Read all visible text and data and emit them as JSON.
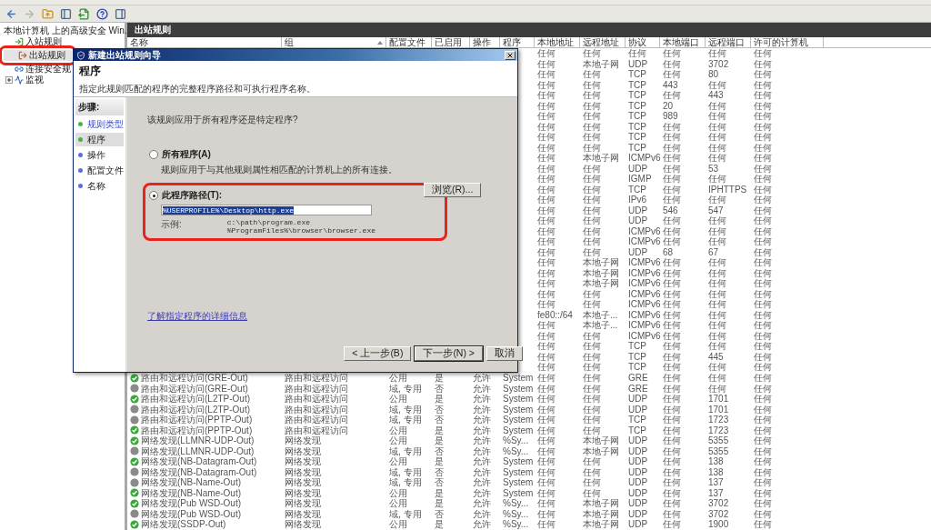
{
  "toolbar": [
    {
      "disabled": false
    },
    {
      "disabled": true
    },
    {
      "disabled": false
    },
    {
      "disabled": false
    },
    {
      "disabled": false
    },
    {
      "disabled": false
    },
    {
      "disabled": false
    }
  ],
  "tree": {
    "root": "本地计算机 上的高级安全 Win.",
    "items": [
      {
        "label": "入站规则",
        "selected": false,
        "highlighted": false
      },
      {
        "label": "出站规则",
        "selected": true,
        "highlighted": true
      },
      {
        "label": "连接安全规",
        "selected": false,
        "highlighted": false
      },
      {
        "label": "监视",
        "selected": false,
        "highlighted": false,
        "expanded": false
      }
    ]
  },
  "panel_title": "出站规则",
  "table": {
    "columns": [
      {
        "label": "名称",
        "sorted": false
      },
      {
        "label": "组",
        "sorted": true
      },
      {
        "label": "配置文件",
        "sorted": false
      },
      {
        "label": "已启用",
        "sorted": false
      },
      {
        "label": "操作",
        "sorted": false
      },
      {
        "label": "程序",
        "sorted": false
      },
      {
        "label": "本地地址",
        "sorted": false
      },
      {
        "label": "远程地址",
        "sorted": false
      },
      {
        "label": "协议",
        "sorted": false
      },
      {
        "label": "本地端口",
        "sorted": false
      },
      {
        "label": "远程端口",
        "sorted": false
      },
      {
        "label": "许可的计算机",
        "sorted": false
      }
    ],
    "rows": [
      {
        "kind": "partial",
        "cells": [
          "任何",
          "任何",
          "任何",
          "任何",
          "任何",
          "任何"
        ]
      },
      {
        "kind": "partial",
        "cells": [
          "任何",
          "本地子网",
          "UDP",
          "任何",
          "3702",
          "任何"
        ]
      },
      {
        "kind": "partial",
        "cells": [
          "任何",
          "任何",
          "TCP",
          "任何",
          "80",
          "任何"
        ]
      },
      {
        "kind": "partial",
        "cells": [
          "任何",
          "任何",
          "TCP",
          "443",
          "任何",
          "任何"
        ]
      },
      {
        "kind": "partial",
        "cells": [
          "任何",
          "任何",
          "TCP",
          "任何",
          "443",
          "任何"
        ]
      },
      {
        "kind": "partial",
        "cells": [
          "任何",
          "任何",
          "TCP",
          "20",
          "任何",
          "任何"
        ]
      },
      {
        "kind": "partial",
        "cells": [
          "任何",
          "任何",
          "TCP",
          "989",
          "任何",
          "任何"
        ]
      },
      {
        "kind": "partial",
        "cells": [
          "任何",
          "任何",
          "TCP",
          "任何",
          "任何",
          "任何"
        ]
      },
      {
        "kind": "partial",
        "cells": [
          "任何",
          "任何",
          "TCP",
          "任何",
          "任何",
          "任何"
        ]
      },
      {
        "kind": "partial",
        "cells": [
          "任何",
          "任何",
          "TCP",
          "任何",
          "任何",
          "任何"
        ]
      },
      {
        "kind": "partial",
        "cells": [
          "任何",
          "本地子网",
          "ICMPv6",
          "任何",
          "任何",
          "任何"
        ]
      },
      {
        "kind": "partial",
        "cells": [
          "任何",
          "任何",
          "UDP",
          "任何",
          "53",
          "任何"
        ]
      },
      {
        "kind": "partial",
        "cells": [
          "任何",
          "任何",
          "IGMP",
          "任何",
          "任何",
          "任何"
        ]
      },
      {
        "kind": "partial",
        "cells": [
          "任何",
          "任何",
          "TCP",
          "任何",
          "IPHTTPS",
          "任何"
        ]
      },
      {
        "kind": "partial",
        "cells": [
          "任何",
          "任何",
          "IPv6",
          "任何",
          "任何",
          "任何"
        ]
      },
      {
        "kind": "partial",
        "cells": [
          "任何",
          "任何",
          "UDP",
          "546",
          "547",
          "任何"
        ]
      },
      {
        "kind": "partial",
        "cells": [
          "任何",
          "任何",
          "UDP",
          "任何",
          "任何",
          "任何"
        ]
      },
      {
        "kind": "partial",
        "cells": [
          "任何",
          "任何",
          "ICMPv6",
          "任何",
          "任何",
          "任何"
        ]
      },
      {
        "kind": "partial",
        "cells": [
          "任何",
          "任何",
          "ICMPv6",
          "任何",
          "任何",
          "任何"
        ]
      },
      {
        "kind": "partial",
        "cells": [
          "任何",
          "任何",
          "UDP",
          "68",
          "67",
          "任何"
        ]
      },
      {
        "kind": "partial",
        "cells": [
          "任何",
          "本地子网",
          "ICMPv6",
          "任何",
          "任何",
          "任何"
        ]
      },
      {
        "kind": "partial",
        "cells": [
          "任何",
          "本地子网",
          "ICMPv6",
          "任何",
          "任何",
          "任何"
        ]
      },
      {
        "kind": "partial",
        "cells": [
          "任何",
          "本地子网",
          "ICMPv6",
          "任何",
          "任何",
          "任何"
        ]
      },
      {
        "kind": "partial",
        "cells": [
          "任何",
          "任何",
          "ICMPv6",
          "任何",
          "任何",
          "任何"
        ]
      },
      {
        "kind": "partial",
        "cells": [
          "任何",
          "任何",
          "ICMPv6",
          "任何",
          "任何",
          "任何"
        ]
      },
      {
        "kind": "partial",
        "cells": [
          "fe80::/64",
          "本地子...",
          "ICMPv6",
          "任何",
          "任何",
          "任何"
        ]
      },
      {
        "kind": "partial",
        "cells": [
          "任何",
          "本地子...",
          "ICMPv6",
          "任何",
          "任何",
          "任何"
        ]
      },
      {
        "kind": "partial",
        "cells": [
          "任何",
          "任何",
          "ICMPv6",
          "任何",
          "任何",
          "任何"
        ]
      },
      {
        "kind": "partial",
        "cells": [
          "任何",
          "任何",
          "TCP",
          "任何",
          "任何",
          "任何"
        ]
      },
      {
        "kind": "partial",
        "cells": [
          "任何",
          "任何",
          "TCP",
          "任何",
          "445",
          "任何"
        ]
      },
      {
        "kind": "partial",
        "cells": [
          "任何",
          "任何",
          "TCP",
          "任何",
          "任何",
          "任何"
        ]
      },
      {
        "kind": "full",
        "on": true,
        "cells": [
          "路由和远程访问(GRE-Out)",
          "路由和远程访问",
          "公用",
          "是",
          "允许",
          "System",
          "任何",
          "任何",
          "GRE",
          "任何",
          "任何",
          "任何"
        ]
      },
      {
        "kind": "full",
        "on": false,
        "cells": [
          "路由和远程访问(GRE-Out)",
          "路由和远程访问",
          "域, 专用",
          "否",
          "允许",
          "System",
          "任何",
          "任何",
          "GRE",
          "任何",
          "任何",
          "任何"
        ]
      },
      {
        "kind": "full",
        "on": true,
        "cells": [
          "路由和远程访问(L2TP-Out)",
          "路由和远程访问",
          "公用",
          "是",
          "允许",
          "System",
          "任何",
          "任何",
          "UDP",
          "任何",
          "1701",
          "任何"
        ]
      },
      {
        "kind": "full",
        "on": false,
        "cells": [
          "路由和远程访问(L2TP-Out)",
          "路由和远程访问",
          "域, 专用",
          "否",
          "允许",
          "System",
          "任何",
          "任何",
          "UDP",
          "任何",
          "1701",
          "任何"
        ]
      },
      {
        "kind": "full",
        "on": false,
        "cells": [
          "路由和远程访问(PPTP-Out)",
          "路由和远程访问",
          "域, 专用",
          "否",
          "允许",
          "System",
          "任何",
          "任何",
          "TCP",
          "任何",
          "1723",
          "任何"
        ]
      },
      {
        "kind": "full",
        "on": true,
        "cells": [
          "路由和远程访问(PPTP-Out)",
          "路由和远程访问",
          "公用",
          "是",
          "允许",
          "System",
          "任何",
          "任何",
          "TCP",
          "任何",
          "1723",
          "任何"
        ]
      },
      {
        "kind": "full",
        "on": true,
        "cells": [
          "网络发现(LLMNR-UDP-Out)",
          "网络发现",
          "公用",
          "是",
          "允许",
          "%Sy...",
          "任何",
          "本地子网",
          "UDP",
          "任何",
          "5355",
          "任何"
        ]
      },
      {
        "kind": "full",
        "on": false,
        "cells": [
          "网络发现(LLMNR-UDP-Out)",
          "网络发现",
          "域, 专用",
          "否",
          "允许",
          "%Sy...",
          "任何",
          "本地子网",
          "UDP",
          "任何",
          "5355",
          "任何"
        ]
      },
      {
        "kind": "full",
        "on": true,
        "cells": [
          "网络发现(NB-Datagram-Out)",
          "网络发现",
          "公用",
          "是",
          "允许",
          "System",
          "任何",
          "任何",
          "UDP",
          "任何",
          "138",
          "任何"
        ]
      },
      {
        "kind": "full",
        "on": false,
        "cells": [
          "网络发现(NB-Datagram-Out)",
          "网络发现",
          "域, 专用",
          "否",
          "允许",
          "System",
          "任何",
          "任何",
          "UDP",
          "任何",
          "138",
          "任何"
        ]
      },
      {
        "kind": "full",
        "on": false,
        "cells": [
          "网络发现(NB-Name-Out)",
          "网络发现",
          "域, 专用",
          "否",
          "允许",
          "System",
          "任何",
          "任何",
          "UDP",
          "任何",
          "137",
          "任何"
        ]
      },
      {
        "kind": "full",
        "on": true,
        "cells": [
          "网络发现(NB-Name-Out)",
          "网络发现",
          "公用",
          "是",
          "允许",
          "System",
          "任何",
          "任何",
          "UDP",
          "任何",
          "137",
          "任何"
        ]
      },
      {
        "kind": "full",
        "on": true,
        "cells": [
          "网络发现(Pub WSD-Out)",
          "网络发现",
          "公用",
          "是",
          "允许",
          "%Sy...",
          "任何",
          "本地子网",
          "UDP",
          "任何",
          "3702",
          "任何"
        ]
      },
      {
        "kind": "full",
        "on": false,
        "cells": [
          "网络发现(Pub WSD-Out)",
          "网络发现",
          "域, 专用",
          "否",
          "允许",
          "%Sy...",
          "任何",
          "本地子网",
          "UDP",
          "任何",
          "3702",
          "任何"
        ]
      },
      {
        "kind": "full",
        "on": true,
        "cells": [
          "网络发现(SSDP-Out)",
          "网络发现",
          "公用",
          "是",
          "允许",
          "%Sy...",
          "任何",
          "本地子网",
          "UDP",
          "任何",
          "1900",
          "任何"
        ]
      }
    ]
  },
  "dialog": {
    "title": "新建出站规则向导",
    "heading": "程序",
    "subtitle": "指定此规则匹配的程序的完整程序路径和可执行程序名称。",
    "steps_title": "步骤:",
    "steps": [
      {
        "label": "规则类型",
        "kind": "link",
        "selected": false,
        "color": "#4caf50"
      },
      {
        "label": "程序",
        "kind": "plain",
        "selected": true,
        "color": "#4caf50"
      },
      {
        "label": "操作",
        "kind": "plain",
        "selected": false,
        "color": "#5b6fd6"
      },
      {
        "label": "配置文件",
        "kind": "plain",
        "selected": false,
        "color": "#5b6fd6"
      },
      {
        "label": "名称",
        "kind": "plain",
        "selected": false,
        "color": "#5b6fd6"
      }
    ],
    "question": "该规则应用于所有程序还是特定程序?",
    "options": [
      {
        "label": "所有程序(A)",
        "selected": false,
        "highlighted": false,
        "description": "规则应用于与其他规则属性相匹配的计算机上的所有连接。"
      },
      {
        "label": "此程序路径(T):",
        "selected": true,
        "highlighted": true
      }
    ],
    "path_field": {
      "value": "%USERPROFILE%\\Desktop\\http.exe",
      "text_selected": true
    },
    "browse_button": "浏览(R)...",
    "example_label": "示例:",
    "examples": [
      "c:\\path\\program.exe",
      "%ProgramFiles%\\browser\\browser.exe"
    ],
    "link": "了解指定程序的详细信息",
    "buttons": [
      {
        "label": "< 上一步(B)",
        "default": false
      },
      {
        "label": "下一步(N) >",
        "default": true
      },
      {
        "label": "取消",
        "default": false
      }
    ]
  }
}
